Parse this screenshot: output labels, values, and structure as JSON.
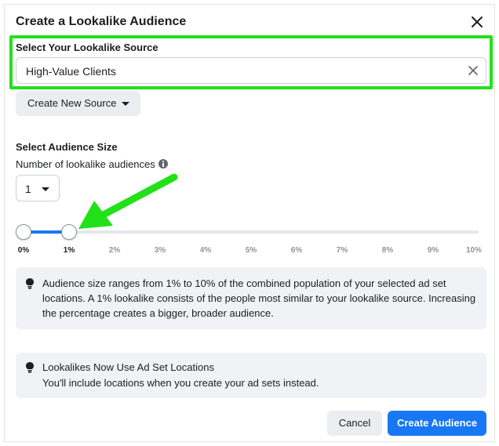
{
  "dialog": {
    "title": "Create a Lookalike Audience"
  },
  "source": {
    "label": "Select Your Lookalike Source",
    "value": "High-Value Clients",
    "new_source_label": "Create New Source"
  },
  "audience_size": {
    "label": "Select Audience Size",
    "number_label": "Number of lookalike audiences",
    "number_value": "1",
    "slider": {
      "min": 0,
      "max": 10,
      "selected_start": 0,
      "selected_end": 1,
      "ticks": [
        "0%",
        "1%",
        "2%",
        "3%",
        "4%",
        "5%",
        "6%",
        "7%",
        "8%",
        "9%",
        "10%"
      ]
    }
  },
  "info": {
    "size_text": "Audience size ranges from 1% to 10% of the combined population of your selected ad set locations. A 1% lookalike consists of the people most similar to your lookalike source. Increasing the percentage creates a bigger, broader audience.",
    "locations_title": "Lookalikes Now Use Ad Set Locations",
    "locations_text": "You'll include locations when you create your ad sets instead."
  },
  "footer": {
    "cancel_label": "Cancel",
    "create_label": "Create Audience"
  },
  "colors": {
    "primary": "#1877f2",
    "highlight": "#22e11a",
    "arrow": "#22e11a"
  }
}
